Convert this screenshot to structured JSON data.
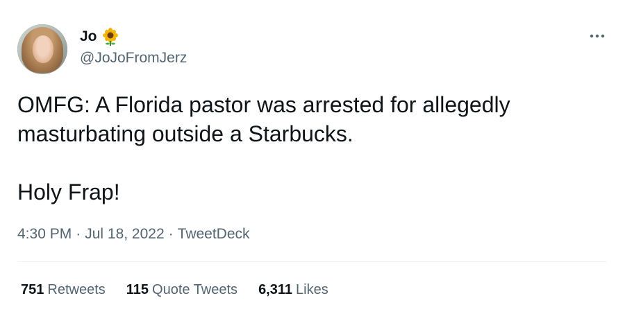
{
  "author": {
    "display_name": "Jo",
    "emoji_icon": "sunflower-icon",
    "handle": "@JoJoFromJerz"
  },
  "tweet": {
    "line1": "OMFG: A Florida pastor was arrested for allegedly",
    "line2": "masturbating outside a Starbucks.",
    "line3": "Holy Frap!"
  },
  "meta": {
    "time": "4:30 PM",
    "separator": "·",
    "date": "Jul 18, 2022",
    "source": "TweetDeck"
  },
  "stats": {
    "retweets_count": "751",
    "retweets_label": "Retweets",
    "quotes_count": "115",
    "quotes_label": "Quote Tweets",
    "likes_count": "6,311",
    "likes_label": "Likes"
  },
  "colors": {
    "text_primary": "#0f1419",
    "text_secondary": "#536471",
    "divider": "#eff3f4"
  }
}
